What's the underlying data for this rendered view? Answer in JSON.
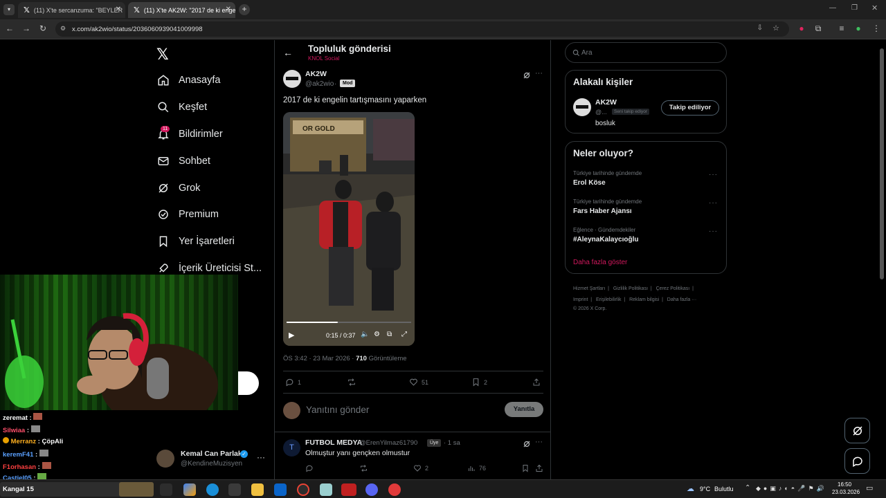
{
  "browser": {
    "tabs": [
      {
        "label": "(11) X'te sercanzuma: \"BEYLER",
        "active": false
      },
      {
        "label": "(11) X'te AK2W: \"2017 de ki enge",
        "active": true
      }
    ],
    "url": "x.com/ak2wio/status/2036060939041009998"
  },
  "nav": {
    "items": [
      {
        "label": "Anasayfa",
        "icon": "home-icon"
      },
      {
        "label": "Keşfet",
        "icon": "search-icon"
      },
      {
        "label": "Bildirimler",
        "icon": "bell-icon"
      },
      {
        "label": "Sohbet",
        "icon": "mail-icon"
      },
      {
        "label": "Grok",
        "icon": "grok-icon"
      },
      {
        "label": "Premium",
        "icon": "premium-icon"
      },
      {
        "label": "Yer İşaretleri",
        "icon": "bookmark-icon"
      },
      {
        "label": "İçerik Üreticisi St...",
        "icon": "rocket-icon"
      }
    ],
    "notification_count": "11",
    "account": {
      "name": "Kemal Can Parlak",
      "handle": "@KendineMuzisyen"
    }
  },
  "post_header": {
    "title": "Topluluk gönderisi",
    "community": "KNOL Social"
  },
  "post": {
    "author": "AK2W",
    "handle": "@ak2wio",
    "role": "Mod",
    "text": "2017 de ki engelin tartışmasını yaparken",
    "video_time": "0:15 / 0:37",
    "video_progress": 0.41,
    "video_sign": "OR GOLD",
    "meta_time": "ÖS 3:42 · 23 Mar 2026 ·",
    "views": "710",
    "views_label": "Görüntüleme",
    "replies": "1",
    "likes": "51",
    "bookmarks": "2"
  },
  "reply_box": {
    "placeholder": "Yanıtını gönder",
    "button": "Yanıtla"
  },
  "reply": {
    "author": "FUTBOL MEDYA",
    "handle": "@ErenYilmaz61790",
    "role": "Üye",
    "time": "· 1 sa",
    "text": "Olmuştur yanı gençken olmustur",
    "likes": "2",
    "views": "76"
  },
  "search": {
    "placeholder": "Ara"
  },
  "related": {
    "title": "Alakalı kişiler",
    "name": "AK2W",
    "handle": "@...",
    "follows_you": "Seni takip ediyor",
    "bio": "bosluk",
    "follow_button": "Takip ediliyor"
  },
  "trends": {
    "title": "Neler oluyor?",
    "items": [
      {
        "category": "Türkiye tarihinde gündemde",
        "name": "Erol Köse"
      },
      {
        "category": "Türkiye tarihinde gündemde",
        "name": "Fars Haber Ajansı"
      },
      {
        "category": "Eğlence · Gündemdekiler",
        "name": "#AleynaKalaycıoğlu"
      }
    ],
    "show_more": "Daha fazla göster"
  },
  "footer": {
    "links": [
      "Hizmet Şartları",
      "Gizlilik Politikası",
      "Çerez Politikası",
      "Imprint",
      "Erişilebilirlik",
      "Reklam bilgisi",
      "Daha fazla ···"
    ],
    "copyright": "© 2026 X Corp."
  },
  "chat": [
    {
      "user": "zeremat",
      "msg": "",
      "color": "#ffffff"
    },
    {
      "user": "Silwiaa",
      "msg": "",
      "color": "#ff4f6a"
    },
    {
      "user": "Merranz",
      "msg": "ÇöpAli",
      "color": "#ffb020"
    },
    {
      "user": "keremF41",
      "msg": "",
      "color": "#5aa0ff"
    },
    {
      "user": "F1orhasan",
      "msg": "",
      "color": "#ff4040"
    },
    {
      "user": "Castiel05",
      "msg": "",
      "color": "#5aa0ff"
    }
  ],
  "taskbar": {
    "search_text": "Kangal 15",
    "weather": "9°C",
    "weather_desc": "Bulutlu",
    "time": "16:50",
    "date": "23.03.2026"
  }
}
